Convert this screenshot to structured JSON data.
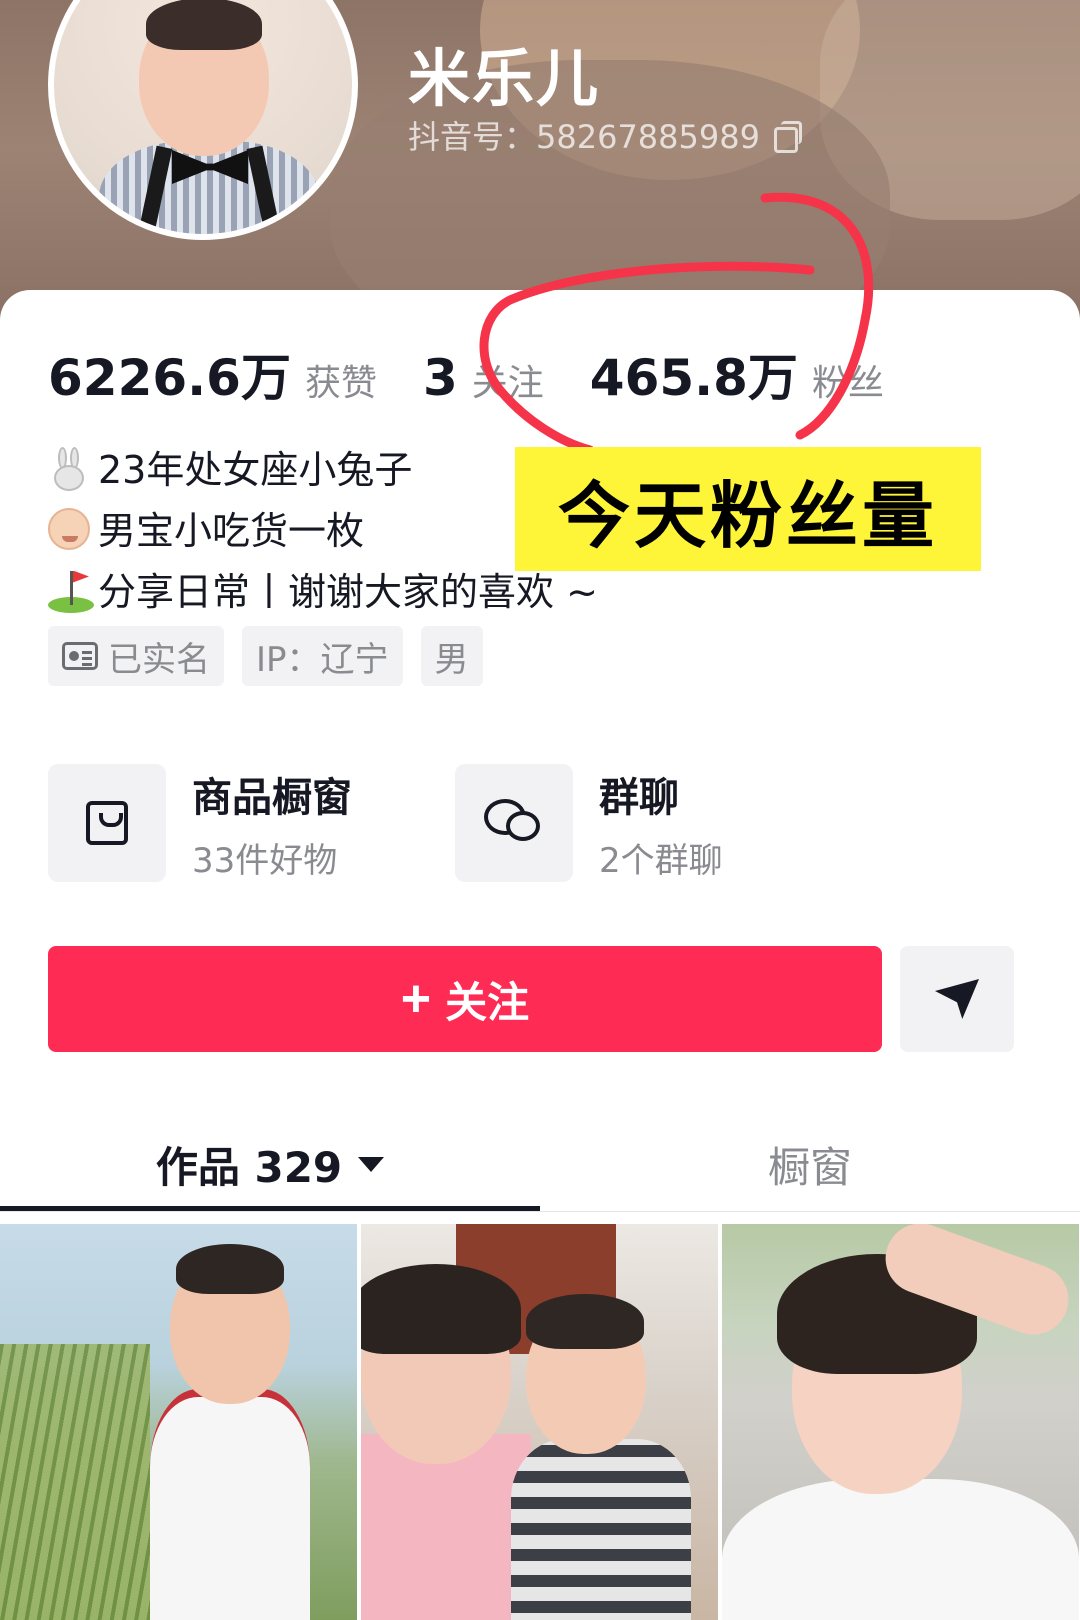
{
  "profile": {
    "nickname": "米乐儿",
    "douyin_id": "抖音号：58267885989"
  },
  "stats": {
    "likes": {
      "value": "6226.6万",
      "label": "获赞"
    },
    "following": {
      "value": "3",
      "label": "关注"
    },
    "followers": {
      "value": "465.8万",
      "label": "粉丝"
    }
  },
  "bio": {
    "lines": [
      {
        "icon": "rabbit-icon",
        "text": "23年处女座小兔子"
      },
      {
        "icon": "baby-icon",
        "text": "男宝小吃货一枚"
      },
      {
        "icon": "golf-flag-icon",
        "text": "分享日常丨谢谢大家的喜欢 ~"
      }
    ]
  },
  "tags": {
    "verified": "已实名",
    "ip": "IP：辽宁",
    "gender": "男"
  },
  "entries": {
    "shop": {
      "title": "商品橱窗",
      "subtitle": "33件好物"
    },
    "group": {
      "title": "群聊",
      "subtitle": "2个群聊"
    }
  },
  "actions": {
    "follow_label": "关注",
    "follow_color": "#fe2c55"
  },
  "tabs": {
    "works": "作品 329",
    "showcase": "橱窗"
  },
  "annotation": {
    "label": "今天粉丝量",
    "highlight_color": "#fff538",
    "circle_color": "#f5344a"
  }
}
